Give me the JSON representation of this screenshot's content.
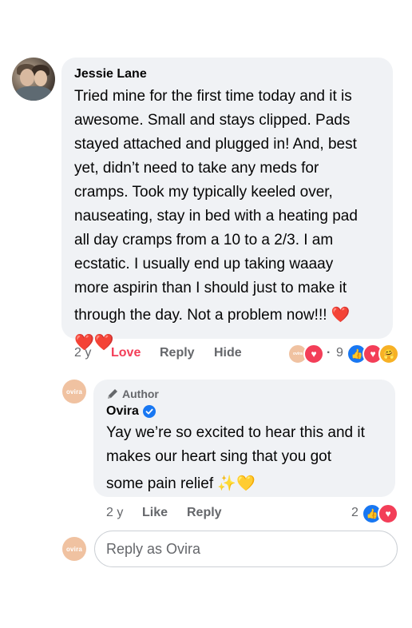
{
  "comment": {
    "author": "Jessie Lane",
    "lines": [
      "Tried mine for the first time today and it is",
      "awesome. Small and stays clipped. Pads",
      "stayed attached and plugged in! And, best",
      "yet, didn’t need to take any meds for",
      "cramps. Took my typically keeled over,",
      "nauseating, stay in bed with a heating pad",
      "all day cramps from a 10 to a 2/3. I am",
      "ecstatic. I usually end up taking waaay",
      "more aspirin than I should just to make it",
      "through the day. Not a problem now!!! ❤️"
    ],
    "trailing_emoji": "❤️❤️",
    "time": "2 y",
    "love_label": "Love",
    "reply_label": "Reply",
    "hide_label": "Hide",
    "reaction_count": "9",
    "reaction_separator": "·"
  },
  "reply": {
    "avatar_text": "ovira",
    "badge_label": "Author",
    "author": "Ovira",
    "lines": [
      "Yay we’re so excited to hear this and it",
      "makes our heart sing that you got",
      "some pain relief ✨💛"
    ],
    "time": "2 y",
    "like_label": "Like",
    "reply_label": "Reply",
    "reaction_count": "2"
  },
  "composer": {
    "avatar_text": "ovira",
    "placeholder": "Reply as Ovira"
  },
  "colors": {
    "love_accent": "#f33e58",
    "like_blue": "#1877f2",
    "bubble_bg": "#f0f2f5",
    "meta_gray": "#65676b",
    "ovira_peach": "#f0c2a1"
  }
}
